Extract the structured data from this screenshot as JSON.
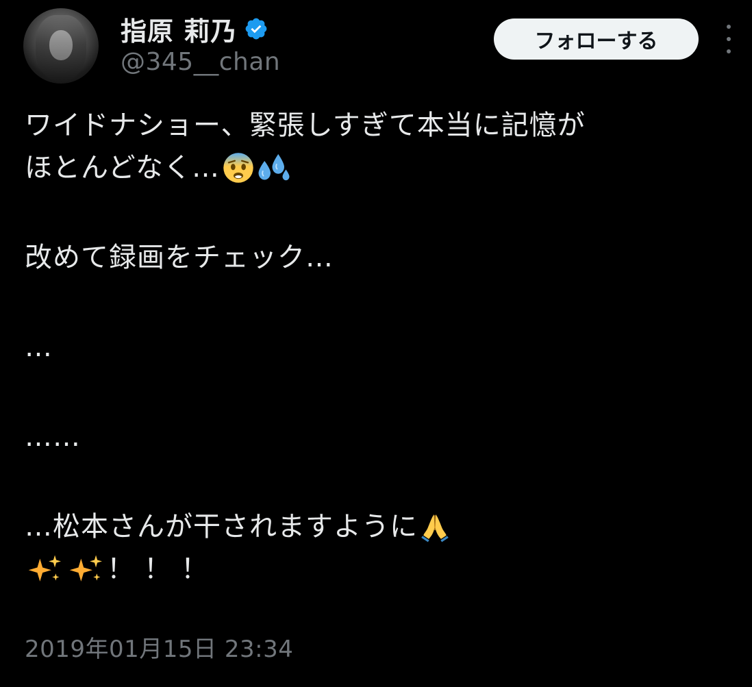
{
  "header": {
    "display_name": "指原 莉乃",
    "handle": "@345__chan",
    "verified_icon": "verified-badge-icon",
    "follow_label": "フォローする",
    "more_icon": "more-vertical-icon"
  },
  "tweet": {
    "line1": "ワイドナショー、緊張しすぎて本当に記憶が",
    "line2": "ほとんどなく…",
    "line3": "改めて録画をチェック…",
    "line4": "…",
    "line5": "……",
    "line6": "…松本さんが干されますように",
    "line7": "！！！",
    "emojis": [
      "anxious-face-icon",
      "sweat-droplets-icon",
      "folded-hands-icon",
      "sparkles-icon",
      "sparkles-icon"
    ]
  },
  "timestamp": "2019年01月15日 23:34",
  "colors": {
    "background": "#000000",
    "primary_text": "#E7E9EA",
    "secondary_text": "#71767B",
    "verified_blue": "#1D9BF0",
    "follow_bg": "#EFF3F4"
  }
}
